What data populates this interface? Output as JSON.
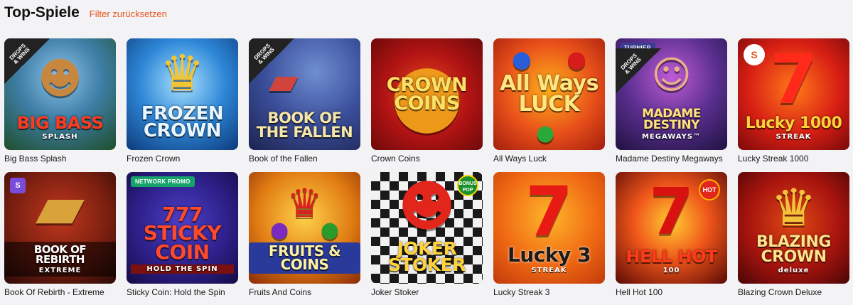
{
  "header": {
    "title": "Top-Spiele",
    "reset_label": "Filter zurücksetzen"
  },
  "games": [
    {
      "name": "Big Bass Splash",
      "logo": "BIG BASS",
      "sub": "SPLASH",
      "ribbon": "DROPS & WINS"
    },
    {
      "name": "Frozen Crown",
      "logo": "FROZEN CROWN"
    },
    {
      "name": "Book of the Fallen",
      "logo": "BOOK OF THE FALLEN",
      "ribbon": "DROPS & WINS"
    },
    {
      "name": "Crown Coins",
      "logo": "CROWN COINS"
    },
    {
      "name": "All Ways Luck",
      "logo": "All Ways LUCK"
    },
    {
      "name": "Madame Destiny Megaways",
      "logo": "MADAME DESTINY",
      "sub": "MEGAWAYS™",
      "ribbon": "DROPS & WINS",
      "tag": "TURNIER"
    },
    {
      "name": "Lucky Streak 1000",
      "logo": "Lucky 1000",
      "sub": "STREAK"
    },
    {
      "name": "Book Of Rebirth - Extreme",
      "logo": "BOOK OF REBIRTH",
      "sub": "EXTREME"
    },
    {
      "name": "Sticky Coin: Hold the Spin",
      "logo": "777 STICKY COIN",
      "sub": "HOLD THE SPIN",
      "tag": "NETWORK PROMO"
    },
    {
      "name": "Fruits And Coins",
      "logo": "FRUITS & COINS"
    },
    {
      "name": "Joker Stoker",
      "logo": "JOKER STOKER",
      "badge": "BONUS POP"
    },
    {
      "name": "Lucky Streak 3",
      "logo": "Lucky 3",
      "sub": "STREAK"
    },
    {
      "name": "Hell Hot 100",
      "logo": "HELL HOT",
      "sub": "100",
      "badge": "HOT"
    },
    {
      "name": "Blazing Crown Deluxe",
      "logo": "BLAZING CROWN",
      "sub": "deluxe"
    }
  ],
  "colors": {
    "accent": "#e8541e",
    "background": "#f3f3f5"
  }
}
